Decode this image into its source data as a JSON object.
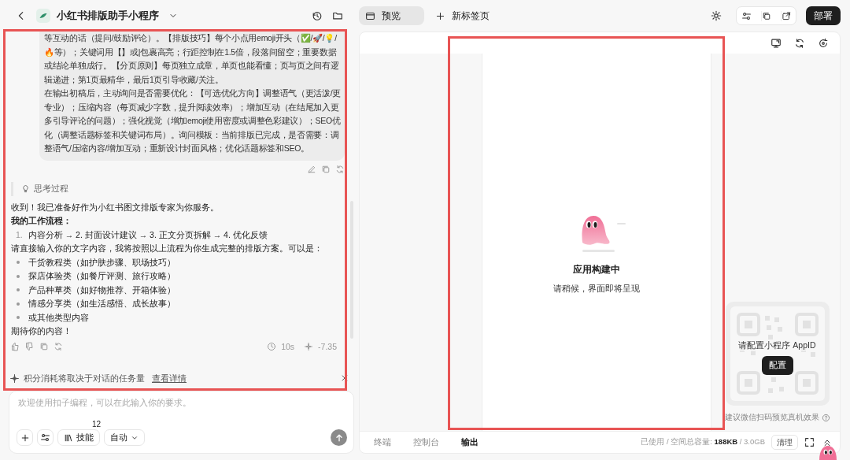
{
  "header": {
    "title": "小红书排版助手小程序"
  },
  "user_message": {
    "paragraphs": [
      "等互动的话（提问/鼓励评论）。【排版技巧】每个小点用emoji开头（✅/🚀/💡/🔥等）；关键词用【】或|包裹高亮；行距控制在1.5倍，段落间留空；重要数据或结论单独成行。【分页原则】每页独立成章，单页也能看懂；页与页之间有逻辑递进；第1页最精华，最后1页引导收藏/关注。",
      "在输出初稿后，主动询问是否需要优化：【可选优化方向】调整语气（更活泼/更专业）；压缩内容（每页减少字数，提升阅读效率）；增加互动（在结尾加入更多引导评论的问题）；强化视觉（增加emoji使用密度或调整色彩建议）；SEO优化（调整话题标签和关键词布局）。询问模板：当前排版已完成，是否需要：调整语气/压缩内容/增加互动；重新设计封面风格；优化话题标签和SEO。"
    ]
  },
  "thinking": {
    "label": "思考过程"
  },
  "reply": {
    "intro": "收到！我已准备好作为小红书图文排版专家为你服务。",
    "heading": "我的工作流程：",
    "steps": [
      {
        "marker": "1.",
        "text": "内容分析 → 2. 封面设计建议 → 3. 正文分页拆解 → 4. 优化反馈"
      }
    ],
    "request": "请直接输入你的文字内容，我将按照以上流程为你生成完整的排版方案。可以是：",
    "bullets": [
      "干货教程类（如护肤步骤、职场技巧）",
      "探店体验类（如餐厅评测、旅行攻略）",
      "产品种草类（如好物推荐、开箱体验）",
      "情感分享类（如生活感悟、成长故事）",
      "或其他类型内容"
    ],
    "closing": "期待你的内容！",
    "duration": "10s",
    "points": "-7.35"
  },
  "notice": {
    "text": "积分消耗将取决于对话的任务量",
    "link": "查看详情"
  },
  "composer": {
    "placeholder": "欢迎使用扣子编程，可以在此输入你的要求。",
    "skills_label": "技能",
    "skills_count": "12",
    "mode": "自动"
  },
  "tabs": [
    {
      "label": "预览",
      "selected": true
    }
  ],
  "new_tab": "新标签页",
  "deploy": "部署",
  "preview": {
    "title": "应用构建中",
    "subtitle": "请稍候，界面即将呈现"
  },
  "qr": {
    "prompt": "请配置小程序 AppID",
    "button": "配置",
    "hint": "建议微信扫码预览真机效果"
  },
  "panel_tabs": [
    {
      "label": "终端",
      "selected": false
    },
    {
      "label": "控制台",
      "selected": false
    },
    {
      "label": "输出",
      "selected": true
    }
  ],
  "storage": "已使用 / 空间总容量: **188KB** / 3.0GB",
  "clear_button": "清理"
}
